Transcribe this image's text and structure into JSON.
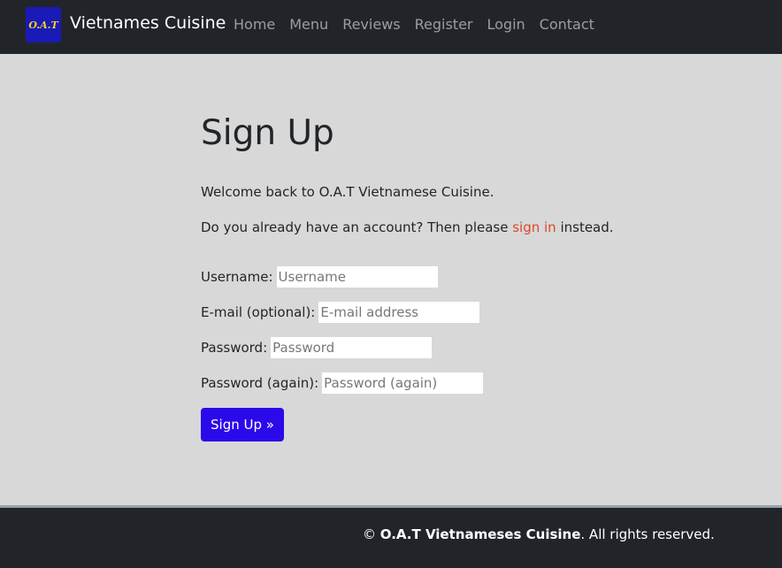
{
  "header": {
    "logo_text": "O.A.T",
    "brand": "Vietnames Cuisine",
    "nav": [
      {
        "label": "Home"
      },
      {
        "label": "Menu"
      },
      {
        "label": "Reviews"
      },
      {
        "label": "Register"
      },
      {
        "label": "Login"
      },
      {
        "label": "Contact"
      }
    ]
  },
  "main": {
    "title": "Sign Up",
    "welcome": "Welcome back to O.A.T Vietnamese Cuisine.",
    "account_prefix": "Do you already have an account? Then please ",
    "signin_link": "sign in",
    "account_suffix": " instead.",
    "form": {
      "username_label": "Username:",
      "username_placeholder": "Username",
      "email_label": "E-mail (optional):",
      "email_placeholder": "E-mail address",
      "password_label": "Password:",
      "password_placeholder": "Password",
      "password2_label": "Password (again):",
      "password2_placeholder": "Password (again)",
      "submit_label": "Sign Up »"
    }
  },
  "footer": {
    "copyright_symbol": "© ",
    "company": "O.A.T Vietnameses Cuisine",
    "rights": ". All rights reserved."
  },
  "colors": {
    "navbar": "#212529",
    "page_bg": "#d8d8d8",
    "link": "#dc4a25",
    "button": "#2a0aea"
  }
}
